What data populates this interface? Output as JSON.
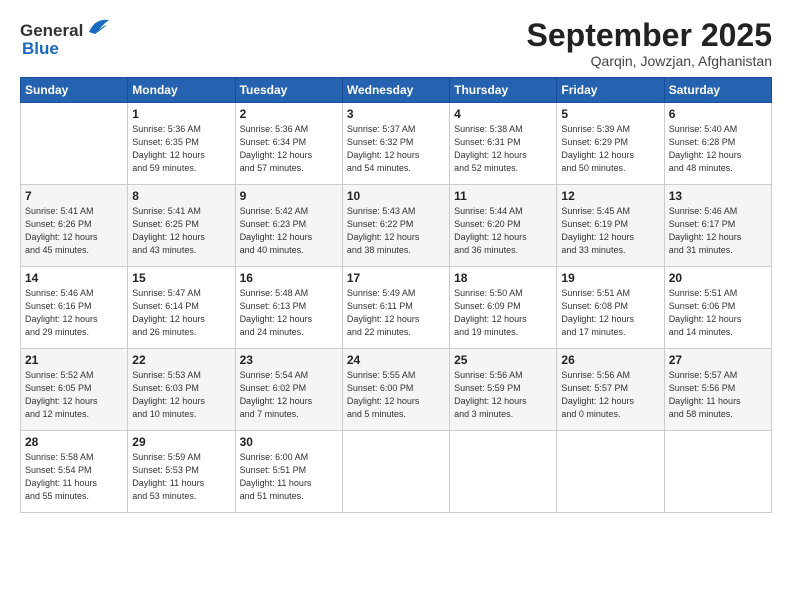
{
  "logo": {
    "line1": "General",
    "line2": "Blue"
  },
  "title": "September 2025",
  "location": "Qarqin, Jowzjan, Afghanistan",
  "weekdays": [
    "Sunday",
    "Monday",
    "Tuesday",
    "Wednesday",
    "Thursday",
    "Friday",
    "Saturday"
  ],
  "weeks": [
    [
      {
        "day": "",
        "info": ""
      },
      {
        "day": "1",
        "info": "Sunrise: 5:36 AM\nSunset: 6:35 PM\nDaylight: 12 hours\nand 59 minutes."
      },
      {
        "day": "2",
        "info": "Sunrise: 5:36 AM\nSunset: 6:34 PM\nDaylight: 12 hours\nand 57 minutes."
      },
      {
        "day": "3",
        "info": "Sunrise: 5:37 AM\nSunset: 6:32 PM\nDaylight: 12 hours\nand 54 minutes."
      },
      {
        "day": "4",
        "info": "Sunrise: 5:38 AM\nSunset: 6:31 PM\nDaylight: 12 hours\nand 52 minutes."
      },
      {
        "day": "5",
        "info": "Sunrise: 5:39 AM\nSunset: 6:29 PM\nDaylight: 12 hours\nand 50 minutes."
      },
      {
        "day": "6",
        "info": "Sunrise: 5:40 AM\nSunset: 6:28 PM\nDaylight: 12 hours\nand 48 minutes."
      }
    ],
    [
      {
        "day": "7",
        "info": "Sunrise: 5:41 AM\nSunset: 6:26 PM\nDaylight: 12 hours\nand 45 minutes."
      },
      {
        "day": "8",
        "info": "Sunrise: 5:41 AM\nSunset: 6:25 PM\nDaylight: 12 hours\nand 43 minutes."
      },
      {
        "day": "9",
        "info": "Sunrise: 5:42 AM\nSunset: 6:23 PM\nDaylight: 12 hours\nand 40 minutes."
      },
      {
        "day": "10",
        "info": "Sunrise: 5:43 AM\nSunset: 6:22 PM\nDaylight: 12 hours\nand 38 minutes."
      },
      {
        "day": "11",
        "info": "Sunrise: 5:44 AM\nSunset: 6:20 PM\nDaylight: 12 hours\nand 36 minutes."
      },
      {
        "day": "12",
        "info": "Sunrise: 5:45 AM\nSunset: 6:19 PM\nDaylight: 12 hours\nand 33 minutes."
      },
      {
        "day": "13",
        "info": "Sunrise: 5:46 AM\nSunset: 6:17 PM\nDaylight: 12 hours\nand 31 minutes."
      }
    ],
    [
      {
        "day": "14",
        "info": "Sunrise: 5:46 AM\nSunset: 6:16 PM\nDaylight: 12 hours\nand 29 minutes."
      },
      {
        "day": "15",
        "info": "Sunrise: 5:47 AM\nSunset: 6:14 PM\nDaylight: 12 hours\nand 26 minutes."
      },
      {
        "day": "16",
        "info": "Sunrise: 5:48 AM\nSunset: 6:13 PM\nDaylight: 12 hours\nand 24 minutes."
      },
      {
        "day": "17",
        "info": "Sunrise: 5:49 AM\nSunset: 6:11 PM\nDaylight: 12 hours\nand 22 minutes."
      },
      {
        "day": "18",
        "info": "Sunrise: 5:50 AM\nSunset: 6:09 PM\nDaylight: 12 hours\nand 19 minutes."
      },
      {
        "day": "19",
        "info": "Sunrise: 5:51 AM\nSunset: 6:08 PM\nDaylight: 12 hours\nand 17 minutes."
      },
      {
        "day": "20",
        "info": "Sunrise: 5:51 AM\nSunset: 6:06 PM\nDaylight: 12 hours\nand 14 minutes."
      }
    ],
    [
      {
        "day": "21",
        "info": "Sunrise: 5:52 AM\nSunset: 6:05 PM\nDaylight: 12 hours\nand 12 minutes."
      },
      {
        "day": "22",
        "info": "Sunrise: 5:53 AM\nSunset: 6:03 PM\nDaylight: 12 hours\nand 10 minutes."
      },
      {
        "day": "23",
        "info": "Sunrise: 5:54 AM\nSunset: 6:02 PM\nDaylight: 12 hours\nand 7 minutes."
      },
      {
        "day": "24",
        "info": "Sunrise: 5:55 AM\nSunset: 6:00 PM\nDaylight: 12 hours\nand 5 minutes."
      },
      {
        "day": "25",
        "info": "Sunrise: 5:56 AM\nSunset: 5:59 PM\nDaylight: 12 hours\nand 3 minutes."
      },
      {
        "day": "26",
        "info": "Sunrise: 5:56 AM\nSunset: 5:57 PM\nDaylight: 12 hours\nand 0 minutes."
      },
      {
        "day": "27",
        "info": "Sunrise: 5:57 AM\nSunset: 5:56 PM\nDaylight: 11 hours\nand 58 minutes."
      }
    ],
    [
      {
        "day": "28",
        "info": "Sunrise: 5:58 AM\nSunset: 5:54 PM\nDaylight: 11 hours\nand 55 minutes."
      },
      {
        "day": "29",
        "info": "Sunrise: 5:59 AM\nSunset: 5:53 PM\nDaylight: 11 hours\nand 53 minutes."
      },
      {
        "day": "30",
        "info": "Sunrise: 6:00 AM\nSunset: 5:51 PM\nDaylight: 11 hours\nand 51 minutes."
      },
      {
        "day": "",
        "info": ""
      },
      {
        "day": "",
        "info": ""
      },
      {
        "day": "",
        "info": ""
      },
      {
        "day": "",
        "info": ""
      }
    ]
  ]
}
